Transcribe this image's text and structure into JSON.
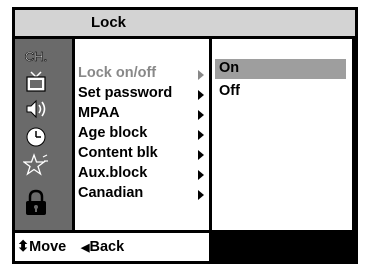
{
  "title": "Lock",
  "icons": [
    {
      "name": "channel-icon",
      "text": "CH."
    },
    {
      "name": "tv-icon"
    },
    {
      "name": "speaker-icon"
    },
    {
      "name": "clock-icon"
    },
    {
      "name": "star-icon"
    },
    {
      "name": "lock-icon"
    }
  ],
  "menu": {
    "items": [
      {
        "label": "Lock on/off",
        "selected": true
      },
      {
        "label": "Set password",
        "selected": false
      },
      {
        "label": "MPAA",
        "selected": false
      },
      {
        "label": "Age block",
        "selected": false
      },
      {
        "label": "Content blk",
        "selected": false
      },
      {
        "label": "Aux.block",
        "selected": false
      },
      {
        "label": "Canadian",
        "selected": false
      }
    ]
  },
  "submenu": {
    "options": [
      {
        "label": "On",
        "highlighted": true
      },
      {
        "label": "Off",
        "highlighted": false
      }
    ]
  },
  "footer": {
    "move_glyph": "⬍",
    "move_label": "Move",
    "back_glyph": "◀",
    "back_label": "Back"
  },
  "colors": {
    "frame": "#000000",
    "title_bar": "#d3d3d3",
    "icon_column": "#6a6a6a",
    "panel": "#ffffff",
    "highlight": "#9e9e9e",
    "selected_text": "#888888"
  }
}
